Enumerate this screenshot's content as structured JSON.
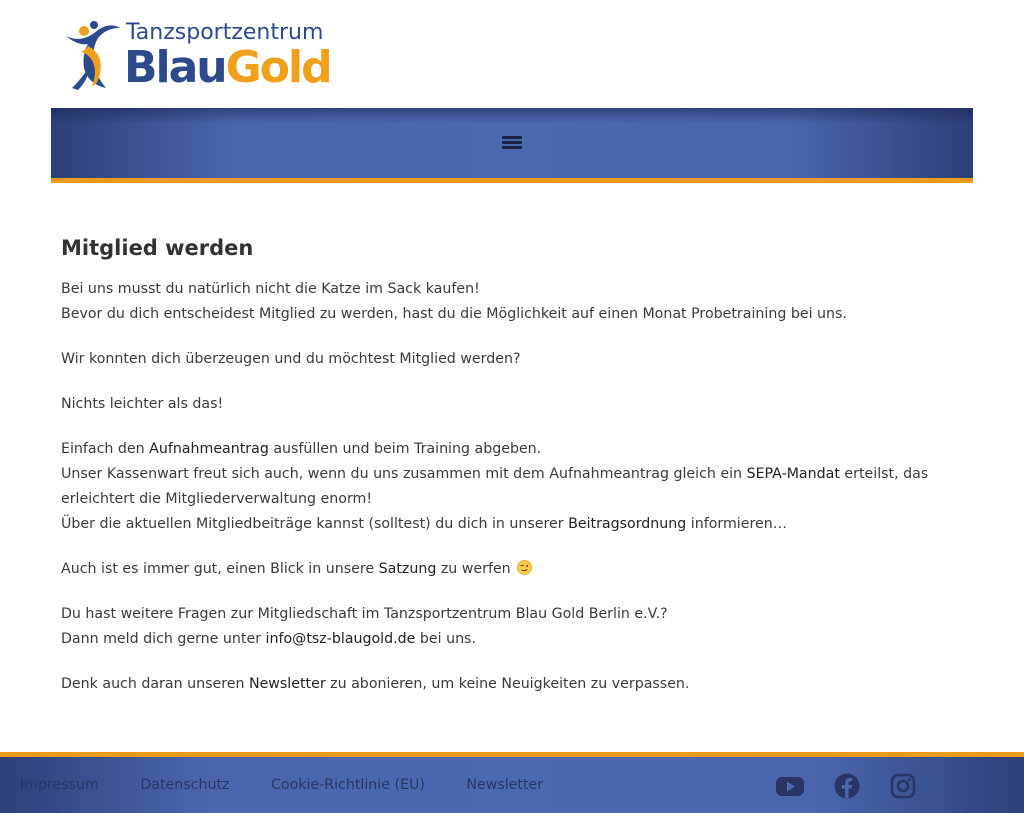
{
  "logo": {
    "line1": "Tanzsportzentrum",
    "word_blau": "Blau",
    "word_gold": "Gold",
    "color_blue": "#2d4a8c",
    "color_gold": "#f0a01c"
  },
  "nav": {
    "menu_icon": "hamburger-menu-icon",
    "bar_color": "#4a69b1",
    "accent": "#eb9a1c"
  },
  "main": {
    "title": "Mitglied werden",
    "p1_line1": "Bei uns musst du natürlich nicht die Katze im Sack kaufen!",
    "p1_line2": "Bevor du dich entscheidest Mitglied zu werden, hast du die Möglichkeit auf einen Monat Probetraining bei uns.",
    "p2": "Wir konnten dich überzeugen und du möchtest Mitglied werden?",
    "p3": "Nichts leichter als das!",
    "p4_a": "Einfach den ",
    "p4_link_aufnahme": "Aufnahmeantrag",
    "p4_b": " ausfüllen und beim Training abgeben.",
    "p4_c": "Unser Kassenwart freut sich auch, wenn du uns zusammen mit dem Aufnahmeantrag gleich ein ",
    "p4_link_sepa": "SEPA-Mandat",
    "p4_d": " erteilst, das erleichtert die Mitgliederverwaltung enorm!",
    "p4_e": "Über die aktuellen Mitgliedbeiträge kannst (solltest) du dich in unserer ",
    "p4_link_beitrag": "Beitragsordnung",
    "p4_f": " informieren…",
    "p5_a": "Auch ist es immer gut, einen Blick in unsere ",
    "p5_link_satzung": "Satzung",
    "p5_b": " zu werfen",
    "p5_emoji": "winking-face-icon",
    "p6_line1": "Du hast weitere Fragen zur Mitgliedschaft im Tanzsportzentrum Blau Gold Berlin e.V.?",
    "p6_a": "Dann meld dich gerne unter ",
    "p6_link_email": "info@tsz-blaugold.de",
    "p6_b": " bei uns.",
    "p7_a": "Denk auch daran unseren ",
    "p7_link_newsletter": "Newsletter",
    "p7_b": " zu abonieren, um keine Neuigkeiten zu verpassen."
  },
  "footer": {
    "links": [
      "Impressum",
      "Datenschutz",
      "Cookie-Richtlinie (EU)",
      "Newsletter"
    ],
    "social_icons": [
      "youtube-icon",
      "facebook-icon",
      "instagram-icon"
    ]
  }
}
